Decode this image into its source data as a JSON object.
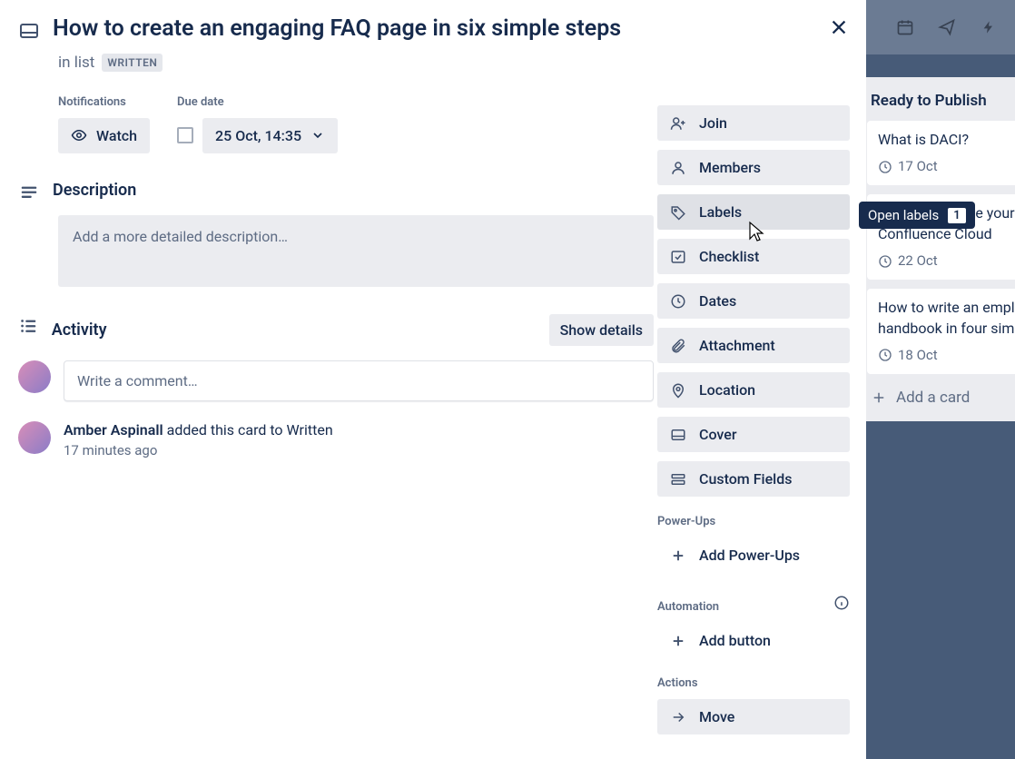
{
  "card": {
    "title": "How to create an engaging FAQ page in six simple steps",
    "in_list_prefix": "in list",
    "list_name": "WRITTEN"
  },
  "meta": {
    "notifications_label": "Notifications",
    "watch_label": "Watch",
    "due_date_label": "Due date",
    "due_date_value": "25 Oct, 14:35"
  },
  "description": {
    "heading": "Description",
    "placeholder": "Add a more detailed description…"
  },
  "activity": {
    "heading": "Activity",
    "show_details": "Show details",
    "comment_placeholder": "Write a comment…",
    "entry": {
      "author": "Amber Aspinall",
      "text": " added this card to Written",
      "time": "17 minutes ago"
    }
  },
  "sidebar": {
    "add": [
      {
        "label": "Join",
        "icon": "user-plus-icon"
      },
      {
        "label": "Members",
        "icon": "user-icon"
      },
      {
        "label": "Labels",
        "icon": "tag-icon",
        "hover": true
      },
      {
        "label": "Checklist",
        "icon": "check-square-icon"
      },
      {
        "label": "Dates",
        "icon": "clock-icon"
      },
      {
        "label": "Attachment",
        "icon": "paperclip-icon"
      },
      {
        "label": "Location",
        "icon": "map-pin-icon"
      },
      {
        "label": "Cover",
        "icon": "cover-icon"
      },
      {
        "label": "Custom Fields",
        "icon": "fields-icon"
      }
    ],
    "powerups_heading": "Power-Ups",
    "add_powerups": "Add Power-Ups",
    "automation_heading": "Automation",
    "add_button": "Add button",
    "actions_heading": "Actions",
    "move": "Move"
  },
  "tooltip": {
    "text": "Open labels",
    "key": "1"
  },
  "board": {
    "column_title": "Ready to Publish",
    "cards": [
      {
        "title": "What is DACI?",
        "date": "17 Oct"
      },
      {
        "title": "How to organize your pages in Confluence Cloud",
        "date": "22 Oct"
      },
      {
        "title": "How to write an employee handbook in four simple steps",
        "date": "18 Oct"
      }
    ],
    "add_card": "Add a card"
  }
}
